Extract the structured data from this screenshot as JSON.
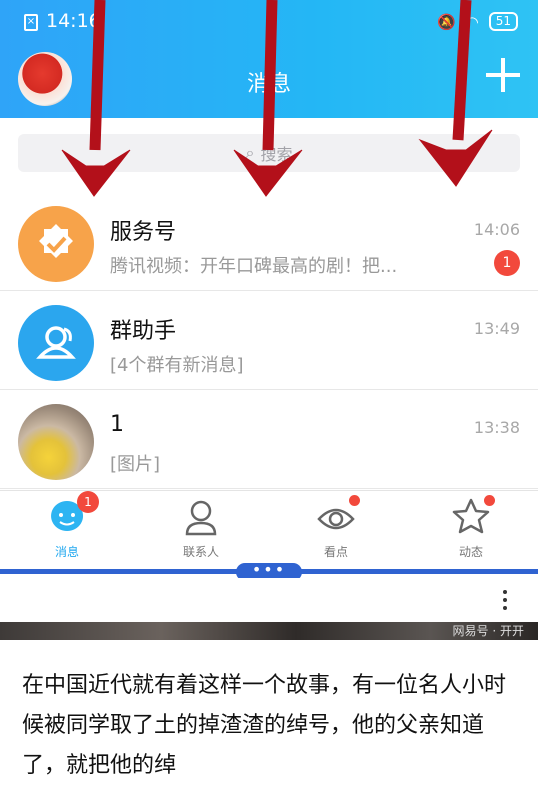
{
  "status_bar": {
    "time": "14:16",
    "battery": "51"
  },
  "header": {
    "title": "消息"
  },
  "search": {
    "placeholder": "搜索"
  },
  "messages": [
    {
      "name": "服务号",
      "preview": "腾讯视频：开年口碑最高的剧！把...",
      "time": "14:06",
      "badge": "1",
      "icon": "service-account-icon",
      "color": "#f7a34a"
    },
    {
      "name": "群助手",
      "preview": "[4个群有新消息]",
      "time": "13:49",
      "badge": "",
      "icon": "group-assistant-icon",
      "color": "#2ba6ee"
    },
    {
      "name": "1",
      "preview": "[图片]",
      "time": "13:38",
      "badge": "",
      "icon": "contact-avatar",
      "color": "#d9c8a0"
    }
  ],
  "tabs": [
    {
      "label": "消息",
      "badge": "1",
      "icon": "message-tab-icon",
      "active": true
    },
    {
      "label": "联系人",
      "badge": "",
      "icon": "contacts-tab-icon",
      "active": false
    },
    {
      "label": "看点",
      "badge": "dot",
      "icon": "watch-tab-icon",
      "active": false
    },
    {
      "label": "动态",
      "badge": "dot",
      "icon": "star-tab-icon",
      "active": false
    }
  ],
  "split_handle": "•••",
  "article": {
    "image_caption": "网易号 · 开开",
    "text": "在中国近代就有着这样一个故事，有一位名人小时候被同学取了土的掉渣渣的绰号，他的父亲知道了，就把他的绰"
  },
  "colors": {
    "header": "#2fa4f8",
    "badge": "#f2493c",
    "accent_blue": "#2f63d1",
    "arrow": "#b3101a"
  }
}
